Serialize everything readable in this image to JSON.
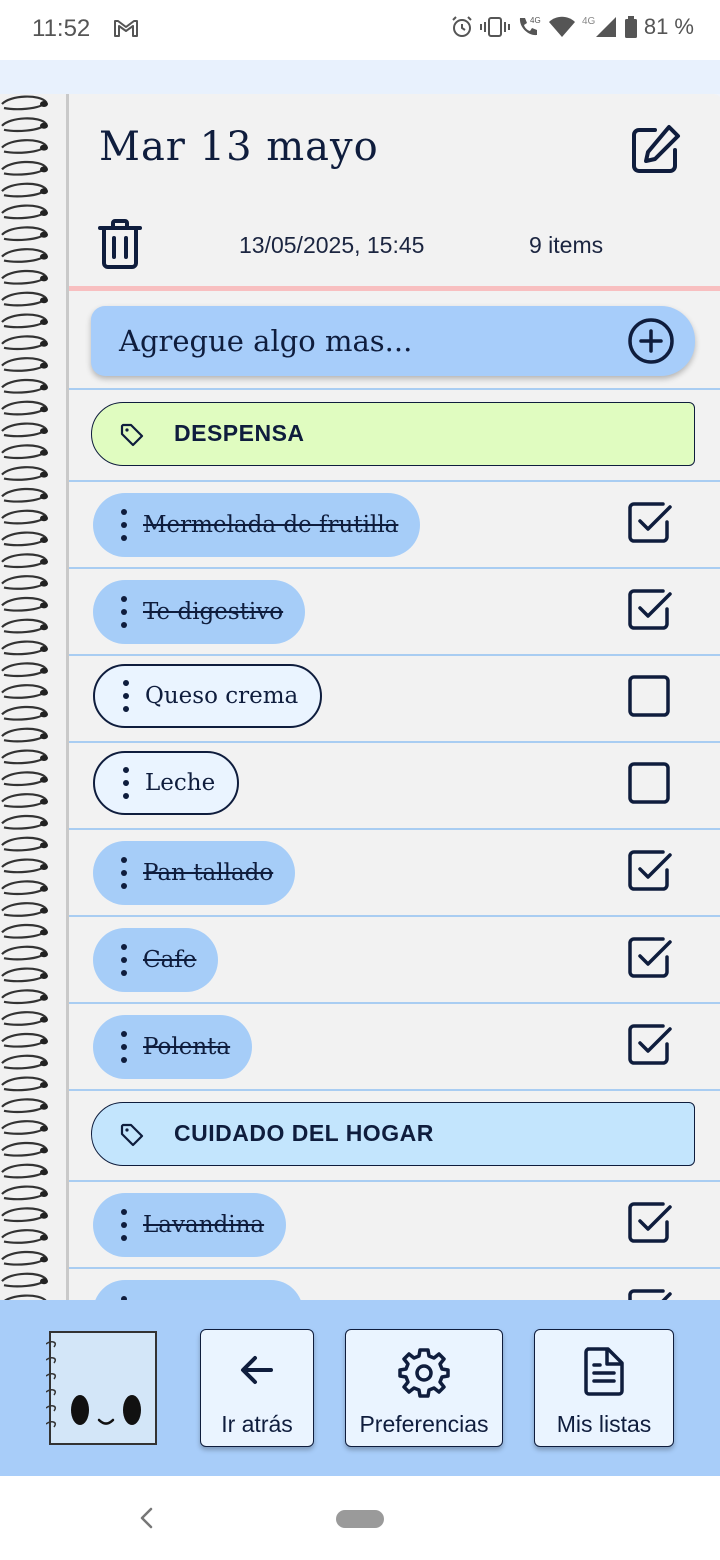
{
  "status_bar": {
    "time": "11:52",
    "battery": "81 %"
  },
  "header": {
    "title": "Mar 13 mayo",
    "date": "13/05/2025, 15:45",
    "count": "9 items"
  },
  "add_input": {
    "placeholder": "Agregue algo mas..."
  },
  "categories": [
    {
      "label": "DESPENSA",
      "color": "#e0fcc0"
    },
    {
      "label": "CUIDADO DEL HOGAR",
      "color": "#c3e5fd"
    }
  ],
  "items": [
    {
      "label": "Mermelada de frutilla",
      "checked": true
    },
    {
      "label": "Te digestivo",
      "checked": true
    },
    {
      "label": "Queso crema",
      "checked": false
    },
    {
      "label": "Leche",
      "checked": false
    },
    {
      "label": "Pan tallado",
      "checked": true
    },
    {
      "label": "Cafe",
      "checked": true
    },
    {
      "label": "Polenta",
      "checked": true
    },
    {
      "label": "Lavandina",
      "checked": true
    }
  ],
  "bottom_nav": {
    "back_label": "Ir atrás",
    "prefs_label": "Preferencias",
    "lists_label": "Mis listas"
  },
  "colors": {
    "accent_blue": "#a8cdf9",
    "ink": "#0f1d3d",
    "margin_line": "#f8bfc0",
    "rule_line": "#a9cdf2"
  }
}
